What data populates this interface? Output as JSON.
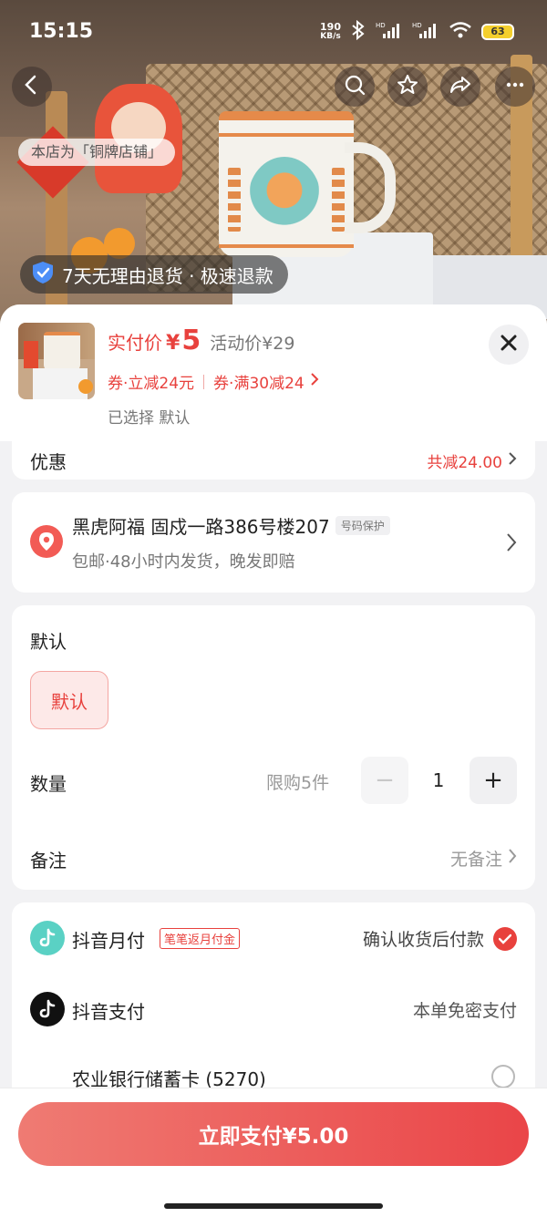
{
  "status_bar": {
    "time": "15:15",
    "net_speed_value": "190",
    "net_speed_unit": "KB/s",
    "battery": "63"
  },
  "hero": {
    "store_tag": "本店为「铜牌店铺」",
    "guarantee": "7天无理由退货 · 极速退款",
    "icons": [
      "back-icon",
      "search-icon",
      "star-icon",
      "share-icon",
      "more-icon"
    ]
  },
  "product": {
    "price_label": "实付价",
    "currency": "¥",
    "price": "5",
    "activity_price": "活动价¥29",
    "coupon_1": "券·立减24元",
    "coupon_2": "券·满30减24",
    "selected": "已选择 默认"
  },
  "discount": {
    "label": "优惠",
    "value": "共减24.00"
  },
  "address": {
    "line": "黑虎阿福  固戍一路386号楼207",
    "protect_tag": "号码保护",
    "shipping": "包邮·48小时内发货，晚发即赔"
  },
  "spec": {
    "title": "默认",
    "option": "默认",
    "qty_label": "数量",
    "qty_limit": "限购5件",
    "minus": "−",
    "qty": "1",
    "plus": "+",
    "note_label": "备注",
    "note_value": "无备注"
  },
  "payment": {
    "monthly_label": "抖音月付",
    "monthly_badge": "笔笔返月付金",
    "monthly_right": "确认收货后付款",
    "douyin_label": "抖音支付",
    "douyin_right": "本单免密支付",
    "card_label": "农业银行储蓄卡 (5270)"
  },
  "footer": {
    "pay_button": "立即支付¥5.00"
  },
  "colors": {
    "accent": "#e8413d",
    "monthly_icon": "#5ad1c4",
    "douyin_icon": "#111111"
  }
}
